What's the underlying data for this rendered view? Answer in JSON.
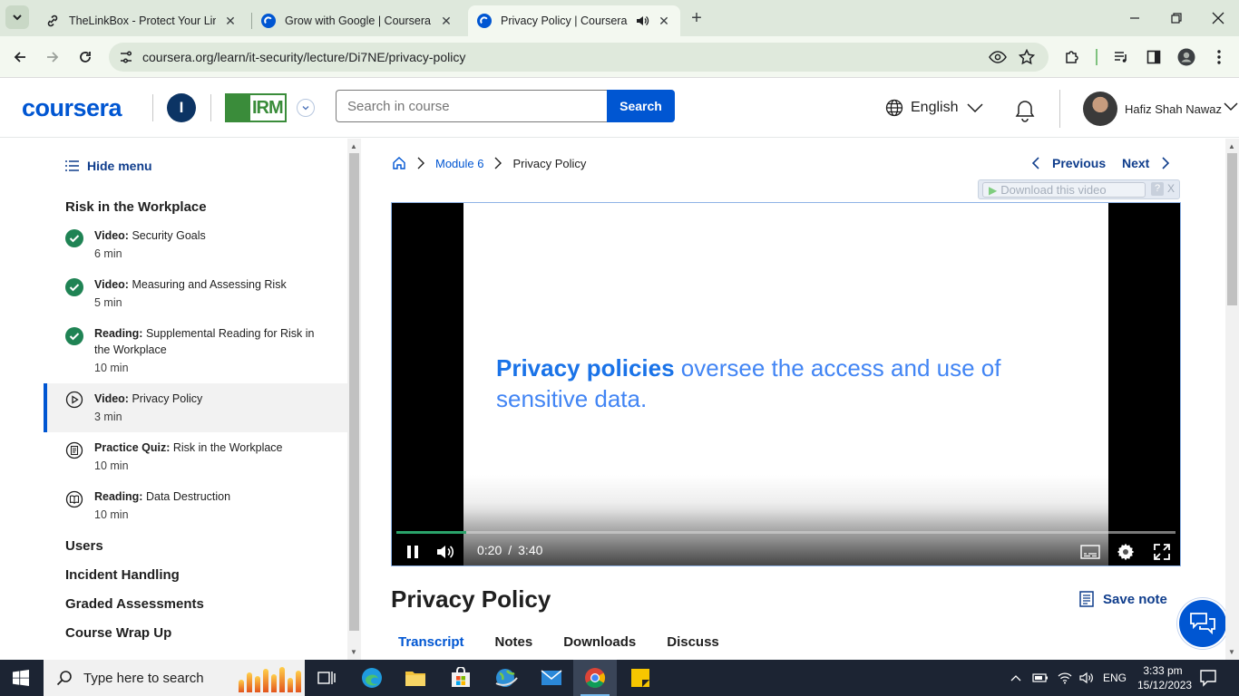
{
  "browser": {
    "tabs": [
      {
        "title": "TheLinkBox - Protect Your Link /",
        "active": false
      },
      {
        "title": "Grow with Google | Coursera",
        "active": false
      },
      {
        "title": "Privacy Policy | Coursera",
        "active": true,
        "audio": true
      }
    ],
    "url": "coursera.org/learn/it-security/lecture/Di7NE/privacy-policy"
  },
  "header": {
    "logo": "coursera",
    "org_initial": "I",
    "partner_logo": "IRM",
    "search_placeholder": "Search in course",
    "search_button": "Search",
    "language": "English",
    "user_name": "Hafiz Shah Nawaz"
  },
  "sidebar": {
    "hide_menu": "Hide menu",
    "module_title": "Risk in the Workplace",
    "items": [
      {
        "type": "Video:",
        "title": "Security Goals",
        "duration": "6 min",
        "status": "completed"
      },
      {
        "type": "Video:",
        "title": "Measuring and Assessing Risk",
        "duration": "5 min",
        "status": "completed"
      },
      {
        "type": "Reading:",
        "title": "Supplemental Reading for Risk in the Workplace",
        "duration": "10 min",
        "status": "completed"
      },
      {
        "type": "Video:",
        "title": "Privacy Policy",
        "duration": "3 min",
        "status": "current"
      },
      {
        "type": "Practice Quiz:",
        "title": "Risk in the Workplace",
        "duration": "10 min",
        "status": "quiz"
      },
      {
        "type": "Reading:",
        "title": "Data Destruction",
        "duration": "10 min",
        "status": "reading"
      }
    ],
    "sections": [
      "Users",
      "Incident Handling",
      "Graded Assessments",
      "Course Wrap Up"
    ]
  },
  "main": {
    "breadcrumb": {
      "module": "Module 6",
      "current": "Privacy Policy"
    },
    "previous": "Previous",
    "next": "Next",
    "download_label": "Download this video",
    "download_help": "?",
    "download_close": "X",
    "video": {
      "caption_bold": "Privacy policies",
      "caption_rest": " oversee the access and use of sensitive data.",
      "current_time": "0:20",
      "time_separator": "/",
      "duration": "3:40",
      "progress": 0.09
    },
    "lesson_title": "Privacy Policy",
    "save_note": "Save note",
    "tabs": [
      "Transcript",
      "Notes",
      "Downloads",
      "Discuss"
    ],
    "active_tab": "Transcript"
  },
  "taskbar": {
    "search_placeholder": "Type here to search",
    "language": "ENG",
    "time": "3:33 pm",
    "date": "15/12/2023"
  },
  "colors": {
    "brand": "#0056d2",
    "link_dark": "#0f3d8c",
    "completed": "#1f8354",
    "caption": "#4285f4",
    "progress": "#2aa36a"
  }
}
